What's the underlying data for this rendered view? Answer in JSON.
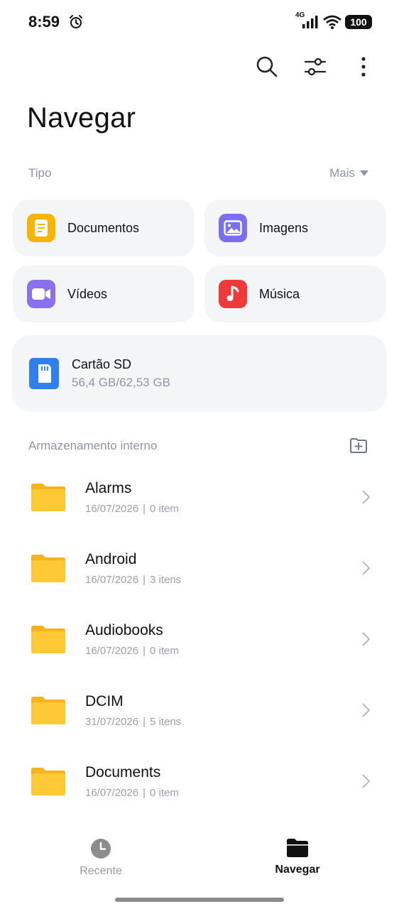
{
  "status_bar": {
    "time": "8:59",
    "network": "4G",
    "battery": "100"
  },
  "header": {
    "title": "Navegar"
  },
  "tipo": {
    "label": "Tipo",
    "more_label": "Mais",
    "items": [
      {
        "label": "Documentos",
        "icon": "document-icon",
        "color": "#f7b500"
      },
      {
        "label": "Imagens",
        "icon": "image-icon",
        "color": "#7b6ff0"
      },
      {
        "label": "Vídeos",
        "icon": "video-icon",
        "color": "#8a6ff0"
      },
      {
        "label": "Música",
        "icon": "music-icon",
        "color": "#f03a3a"
      }
    ]
  },
  "sd_card": {
    "title": "Cartão SD",
    "size": "56,4 GB/62,53 GB",
    "color": "#2f80ed"
  },
  "storage": {
    "label": "Armazenamento interno",
    "folders": [
      {
        "name": "Alarms",
        "date": "16/07/2026",
        "count": "0 item"
      },
      {
        "name": "Android",
        "date": "16/07/2026",
        "count": "3 itens"
      },
      {
        "name": "Audiobooks",
        "date": "16/07/2026",
        "count": "0 item"
      },
      {
        "name": "DCIM",
        "date": "31/07/2026",
        "count": "5 itens"
      },
      {
        "name": "Documents",
        "date": "16/07/2026",
        "count": "0 item"
      }
    ]
  },
  "bottom_nav": {
    "recent_label": "Recente",
    "browse_label": "Navegar"
  }
}
